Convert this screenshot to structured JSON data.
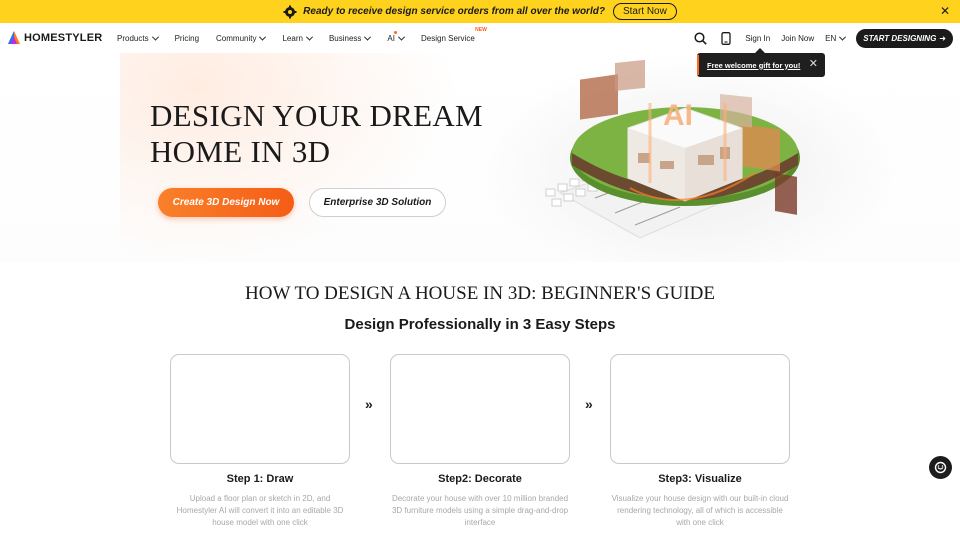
{
  "banner": {
    "message": "Ready to receive design service orders from all over the world?",
    "button": "Start Now",
    "close": "✕",
    "bg_color": "#ffd21e"
  },
  "nav": {
    "brand": "HOMESTYLER",
    "items": [
      {
        "label": "Products",
        "dropdown": true
      },
      {
        "label": "Pricing",
        "dropdown": false
      },
      {
        "label": "Community",
        "dropdown": true
      },
      {
        "label": "Learn",
        "dropdown": true
      },
      {
        "label": "Business",
        "dropdown": true
      },
      {
        "label": "AI",
        "dropdown": true
      },
      {
        "label": "Design Service",
        "dropdown": false,
        "badge": "NEW"
      }
    ],
    "sign_in": "Sign In",
    "join_now": "Join Now",
    "language": "EN",
    "cta": "START DESIGNING",
    "icons": [
      "search-icon",
      "mobile-icon",
      "chevron-down-icon",
      "arrow-right-icon"
    ]
  },
  "gift_tooltip": {
    "text": "Free welcome gift for you!",
    "close": "✕"
  },
  "hero": {
    "title_line1": "DESIGN YOUR DREAM",
    "title_line2": "HOME IN 3D",
    "primary_button": "Create 3D Design Now",
    "secondary_button": "Enterprise 3D Solution",
    "illustration_label": "AI",
    "accent_color": "#f55d16"
  },
  "guide": {
    "title": "HOW TO DESIGN A HOUSE IN 3D: BEGINNER'S GUIDE",
    "subtitle": "Design Professionally in 3 Easy Steps",
    "separator": "»",
    "steps": [
      {
        "title": "Step 1: Draw",
        "description": "Upload a floor plan or sketch in 2D, and Homestyler AI will convert it into an editable 3D house model with one click"
      },
      {
        "title": "Step2: Decorate",
        "description": "Decorate your house with over 10 million branded 3D furniture models using a simple drag-and-drop interface"
      },
      {
        "title": "Step3: Visualize",
        "description": "Visualize your house design with our built-in cloud rendering technology, all of which is accessible with one click"
      }
    ]
  },
  "chat_icon": "chat-support-icon"
}
